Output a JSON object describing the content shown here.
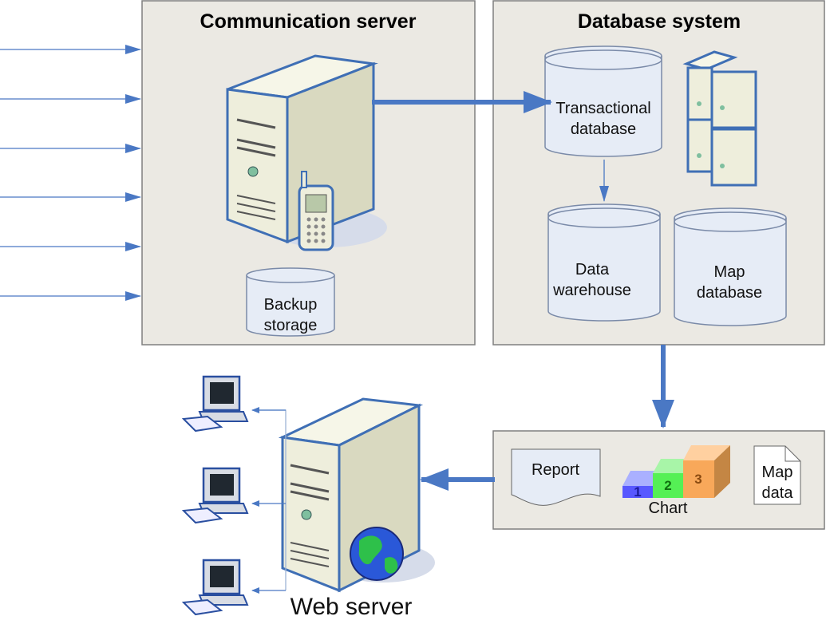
{
  "communication_server": {
    "title": "Communication server",
    "backup": [
      "Backup",
      "storage"
    ]
  },
  "database_system": {
    "title": "Database system",
    "transactional": [
      "Transactional",
      "database"
    ],
    "warehouse": [
      "Data",
      "warehouse"
    ],
    "map_db": [
      "Map",
      "database"
    ]
  },
  "outputs": {
    "report": "Report",
    "chart": "Chart",
    "chart_steps": [
      "1",
      "2",
      "3"
    ],
    "map_data": [
      "Map",
      "data"
    ]
  },
  "web_server": {
    "label": "Web server"
  },
  "colors": {
    "accent": "#4a78c4",
    "panel": "#ebe9e3"
  }
}
